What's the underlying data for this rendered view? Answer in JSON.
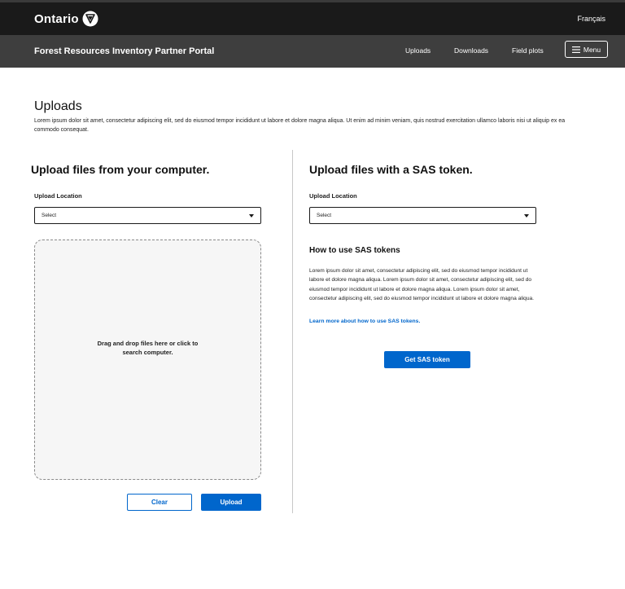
{
  "header": {
    "brand": "Ontario",
    "language_toggle": "Français"
  },
  "subheader": {
    "portal_title": "Forest Resources Inventory Partner Portal",
    "nav": [
      "Uploads",
      "Downloads",
      "Field plots"
    ],
    "menu_label": "Menu"
  },
  "page": {
    "title": "Uploads",
    "intro": "Lorem ipsum dolor sit amet, consectetur adipiscing elit, sed do eiusmod tempor incididunt ut labore et dolore magna aliqua. Ut enim ad minim veniam, quis nostrud exercitation ullamco laboris nisi ut aliquip ex ea commodo consequat."
  },
  "left": {
    "heading": "Upload files from your computer.",
    "location_label": "Upload Location",
    "select_value": "Select",
    "dropzone_text": "Drag and drop files here or click to search computer.",
    "clear_label": "Clear",
    "upload_label": "Upload"
  },
  "right": {
    "heading": "Upload files with a SAS token.",
    "location_label": "Upload Location",
    "select_value": "Select",
    "howto_heading": "How to use SAS tokens",
    "howto_body": "Lorem ipsum dolor sit amet, consectetur adipiscing elit, sed do eiusmod tempor incididunt ut labore et dolore magna aliqua. Lorem ipsum dolor sit amet, consectetur adipiscing elit, sed do eiusmod tempor incididunt ut labore et dolore magna aliqua. Lorem ipsum dolor sit amet, consectetur adipiscing elit, sed do eiusmod tempor incididunt ut labore et dolore magna aliqua.",
    "learn_more_link": "Learn more about how to use SAS tokens.",
    "get_token_label": "Get SAS token"
  },
  "colors": {
    "accent": "#0066cc",
    "topbar": "#1a1a1a",
    "subbar": "#3e3e3e"
  },
  "icons": {
    "brand_mark": "ontario-trillium-icon",
    "menu": "hamburger-icon",
    "select": "caret-down-icon"
  }
}
